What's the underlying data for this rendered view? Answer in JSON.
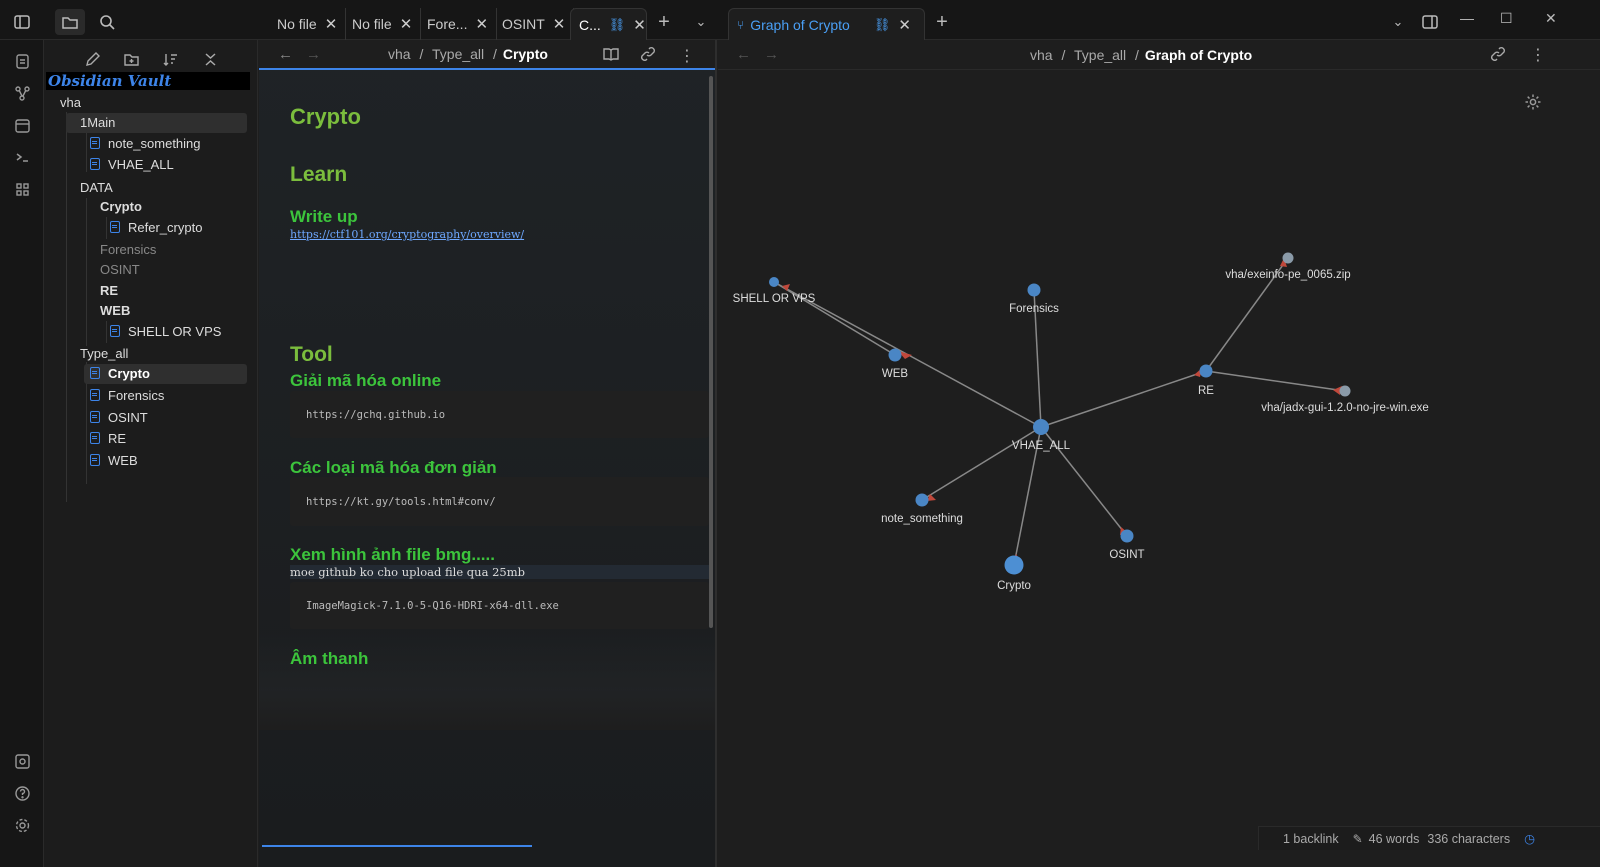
{
  "tabs": [
    {
      "label": "No file"
    },
    {
      "label": "No file"
    },
    {
      "label": "Fore..."
    },
    {
      "label": "OSINT"
    },
    {
      "label": "C..."
    },
    {
      "label": "Graph of Crypto"
    }
  ],
  "sidebar": {
    "vault_title": "Obsidian Vault",
    "tree": [
      {
        "label": "vha",
        "type": "folder"
      },
      {
        "label": "1Main",
        "type": "folder"
      },
      {
        "label": "note_something",
        "type": "file"
      },
      {
        "label": "VHAE_ALL",
        "type": "file"
      },
      {
        "label": "DATA",
        "type": "folder"
      },
      {
        "label": "Crypto",
        "type": "folder"
      },
      {
        "label": "Refer_crypto",
        "type": "file"
      },
      {
        "label": "Forensics",
        "type": "folder"
      },
      {
        "label": "OSINT",
        "type": "folder"
      },
      {
        "label": "RE",
        "type": "folder"
      },
      {
        "label": "WEB",
        "type": "folder"
      },
      {
        "label": "SHELL OR VPS",
        "type": "file"
      },
      {
        "label": "Type_all",
        "type": "folder"
      },
      {
        "label": "Crypto",
        "type": "file"
      },
      {
        "label": "Forensics",
        "type": "file"
      },
      {
        "label": "OSINT",
        "type": "file"
      },
      {
        "label": "RE",
        "type": "file"
      },
      {
        "label": "WEB",
        "type": "file"
      }
    ]
  },
  "editor": {
    "breadcrumb": {
      "p1": "vha",
      "sep1": "/",
      "p2": "Type_all",
      "sep2": "/",
      "current": "Crypto"
    },
    "title": "Crypto",
    "h_learn": "Learn",
    "h_writeup": "Write up",
    "link_writeup": "https://ctf101.org/cryptography/overview/",
    "h_tool": "Tool",
    "h_giaima": "Giải mã hóa online",
    "code1": "https://gchq.github.io",
    "h_cacloai": "Các loại mã hóa đơn giản",
    "code2": "https://kt.gy/tools.html#conv/",
    "h_xemhinh": "Xem hình ảnh file bmg.....",
    "para_xemhinh": "moe github ko cho upload file qua 25mb",
    "code3": "ImageMagick-7.1.0-5-Q16-HDRI-x64-dll.exe",
    "h_amthanh": "Âm thanh"
  },
  "graph": {
    "breadcrumb": {
      "p1": "vha",
      "sep1": "/",
      "p2": "Type_all",
      "sep2": "/",
      "current": "Graph of Crypto"
    },
    "nodes": {
      "shell": "SHELL OR VPS",
      "forensics": "Forensics",
      "exeinfo": "vha/exeinfo-pe_0065.zip",
      "web": "WEB",
      "re": "RE",
      "jadx": "vha/jadx-gui-1.2.0-no-jre-win.exe",
      "vhae": "VHAE_ALL",
      "note": "note_something",
      "osint": "OSINT",
      "crypto": "Crypto"
    }
  },
  "status": {
    "backlinks": "1 backlink",
    "words": "46 words",
    "chars": "336 characters"
  },
  "colors": {
    "accent": "#3d84e8",
    "heading_green": "#3cc43c",
    "title_green": "#7bbd3d",
    "node": "#4a86c5"
  }
}
